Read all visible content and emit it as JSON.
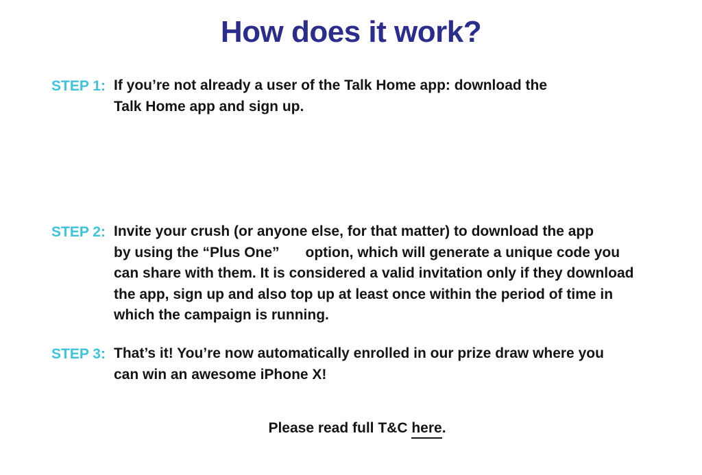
{
  "title": "How does it work?",
  "steps": [
    {
      "label": "STEP 1:",
      "lines": [
        "If you’re not already a user of the Talk Home app: download the",
        "Talk Home app and sign up."
      ]
    },
    {
      "label": "STEP 2:",
      "lines": [
        "Invite your crush (or anyone else, for that matter) to download the app",
        "by using the “Plus One”",
        "option, which will generate a unique code you",
        "can share with them. It is considered a valid invitation only if they download",
        "the app, sign up and also top up at least once within the period of time in",
        "which the campaign is running."
      ]
    },
    {
      "label": "STEP 3:",
      "lines": [
        "That’s it! You’re now automatically enrolled in our prize draw where you",
        "can win an awesome iPhone X!"
      ]
    }
  ],
  "footer": {
    "prefix": "Please read full T&C ",
    "link": "here",
    "suffix": "."
  }
}
